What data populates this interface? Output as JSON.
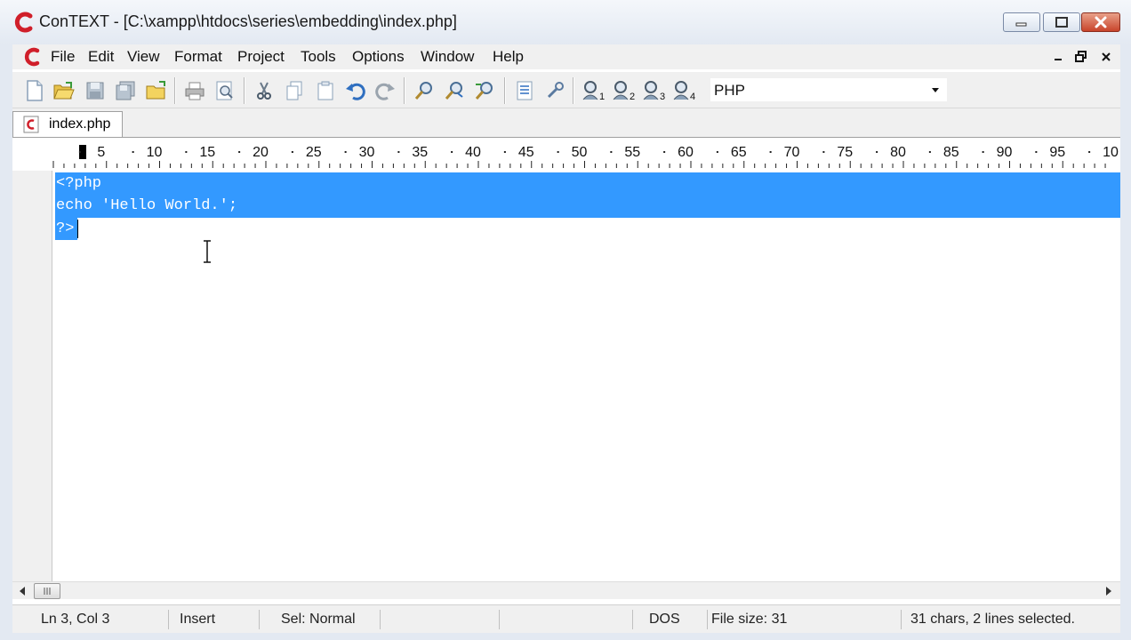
{
  "window": {
    "title": "ConTEXT - [C:\\xampp\\htdocs\\series\\embedding\\index.php]",
    "accent": "#d01f2a"
  },
  "menu": {
    "items": [
      "File",
      "Edit",
      "View",
      "Format",
      "Project",
      "Tools",
      "Options",
      "Window",
      "Help"
    ]
  },
  "toolbar": {
    "syntax_value": "PHP",
    "tool_subscripts": [
      "1",
      "2",
      "3",
      "4"
    ]
  },
  "tabs": [
    {
      "label": "index.php"
    }
  ],
  "ruler": {
    "labels": [
      "5",
      "10",
      "15",
      "20",
      "25",
      "30",
      "35",
      "40",
      "45",
      "50",
      "55",
      "60",
      "65",
      "70",
      "75",
      "80",
      "85",
      "90",
      "95",
      "10"
    ]
  },
  "editor": {
    "lines": [
      "<?php",
      "echo 'Hello World.';",
      "?>"
    ],
    "selection_color": "#3399ff"
  },
  "status": {
    "position": "Ln 3, Col 3",
    "mode": "Insert",
    "selection_mode": "Sel: Normal",
    "line_endings": "DOS",
    "file_size": "File size: 31",
    "selection_info": "31 chars, 2 lines selected."
  }
}
